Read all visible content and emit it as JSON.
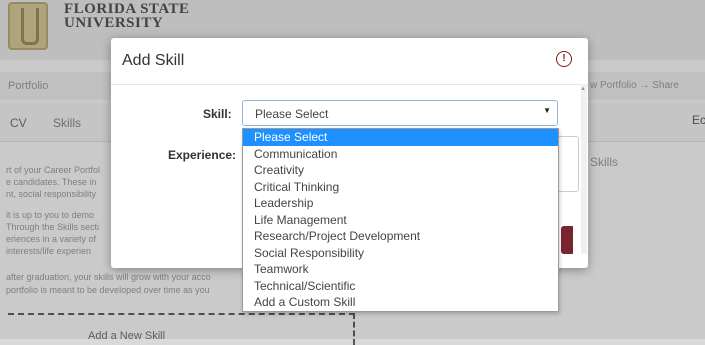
{
  "header": {
    "university_line1": "FLORIDA STATE",
    "university_line2": "UNIVERSITY"
  },
  "nav": {
    "portfolio": "Portfolio",
    "right_text": "w Portfolio → Share"
  },
  "tabs": {
    "cv": "CV",
    "skills": "Skills",
    "right": "Ec"
  },
  "background_text": {
    "skills_heading": "Skills",
    "lines": [
      "rt of your Career Portfol",
      "e candidates. These in",
      "nt, social responsibility",
      "it is up to you to demo",
      "Through the Skills secti",
      "eriences in a variety of",
      "interests/life experien",
      "after graduation, your skills will grow with your acco",
      "portfolio is meant to be developed over time as you"
    ],
    "add_new_skill": "Add a New Skill"
  },
  "modal": {
    "title": "Add Skill",
    "skill_label": "Skill:",
    "experience_label": "Experience:",
    "select_value": "Please Select"
  },
  "dropdown": {
    "options": [
      "Please Select",
      "Communication",
      "Creativity",
      "Critical Thinking",
      "Leadership",
      "Life Management",
      "Research/Project Development",
      "Social Responsibility",
      "Teamwork",
      "Technical/Scientific",
      "Add a Custom Skill"
    ],
    "selected": "Please Select"
  },
  "colors": {
    "accent_blue": "#1e90ff",
    "garnet": "#7a2331",
    "close_icon": "#8b1a1a"
  }
}
